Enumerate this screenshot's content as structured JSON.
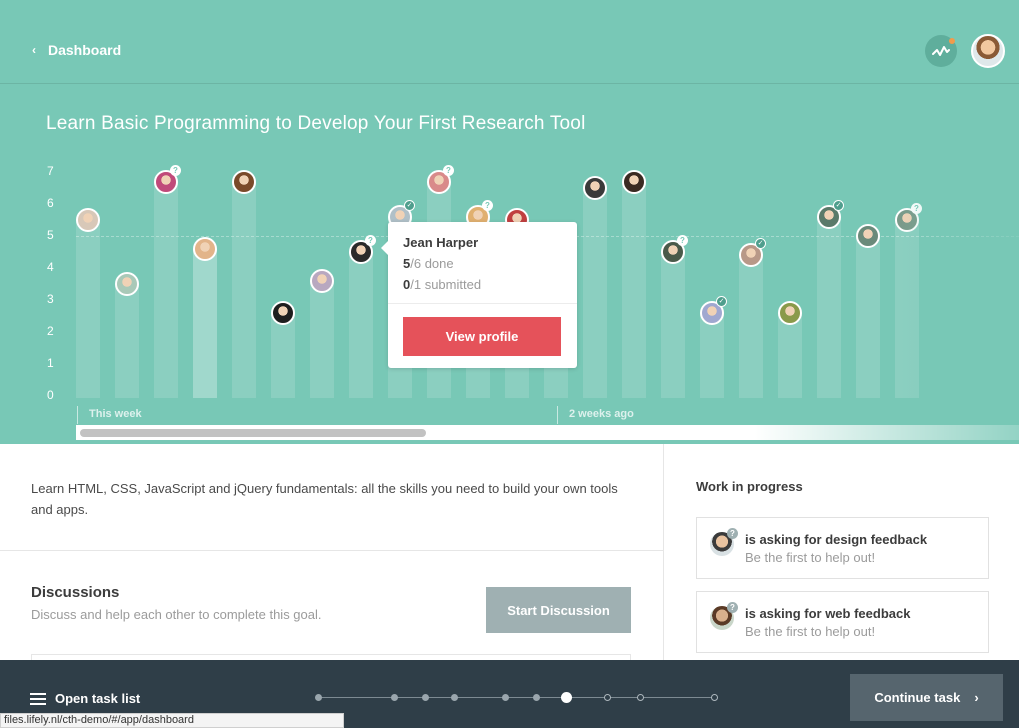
{
  "nav": {
    "back_label": "Dashboard",
    "back_icon": "chevron-left-icon"
  },
  "page": {
    "title": "Learn Basic Programming to Develop Your First Research Tool"
  },
  "chart_data": {
    "type": "bar",
    "y_ticks": [
      "7",
      "6",
      "5",
      "4",
      "3",
      "2",
      "1",
      "0"
    ],
    "ylim": [
      0,
      7
    ],
    "reference_line": 5,
    "x_axis_labels": [
      "This week",
      "2 weeks ago"
    ],
    "series": [
      {
        "values": [
          5.5,
          3.5,
          6.7,
          4.6,
          6.7,
          2.6,
          3.6,
          4.5,
          5.6,
          6.7,
          5.6,
          5.5,
          3.6,
          6.5,
          6.7,
          4.5,
          2.6,
          4.4,
          2.6,
          5.6,
          5.0,
          5.5
        ]
      }
    ],
    "highlighted_bar_index": 3,
    "tooltip_bar_index": 7
  },
  "tooltip": {
    "name": "Jean Harper",
    "done_value": "5",
    "done_rest": "/6 done",
    "submitted_value": "0",
    "submitted_rest": "/1 submitted",
    "button": "View profile"
  },
  "description": "Learn HTML, CSS, JavaScript and jQuery fundamentals: all the skills you need to build your own tools and apps.",
  "discussions": {
    "title": "Discussions",
    "subtitle": "Discuss and help each other to complete this goal.",
    "button": "Start Discussion"
  },
  "wip": {
    "title": "Work in progress",
    "items": [
      {
        "heading": "is asking for design feedback",
        "sub": "Be the first to help out!"
      },
      {
        "heading": "is asking for web feedback",
        "sub": "Be the first to help out!"
      }
    ]
  },
  "footer": {
    "open_task_label": "Open task list",
    "continue_label": "Continue task",
    "progress_steps": 12,
    "progress_active_step": 8
  },
  "status_url": "files.lifely.nl/cth-demo/#/app/dashboard",
  "colors": {
    "header_bg": "#78c8b6",
    "view_profile_button": "#e5525a",
    "bottom_bar": "#2f3e48",
    "continue_button": "#56656e",
    "discussion_button": "#9fb0b2"
  }
}
